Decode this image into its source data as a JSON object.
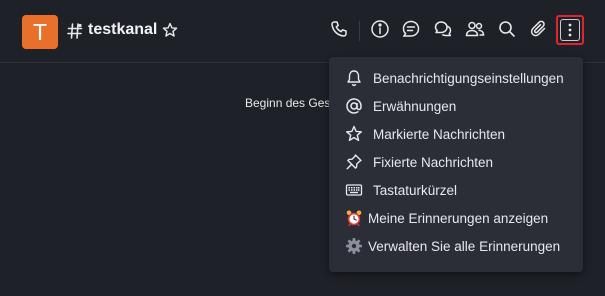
{
  "channel": {
    "avatar_letter": "T",
    "name": "testkanal"
  },
  "toolbar": {
    "icons": [
      "phone-icon",
      "info-icon",
      "threads-icon",
      "discussion-icon",
      "members-icon",
      "search-icon",
      "attachment-icon",
      "kebab-icon"
    ]
  },
  "main": {
    "begin_text": "Beginn des Gesp"
  },
  "menu": {
    "items": [
      {
        "label": "Benachrichtigungseinstellungen",
        "icon": "bell-icon"
      },
      {
        "label": "Erwähnungen",
        "icon": "at-icon"
      },
      {
        "label": "Markierte Nachrichten",
        "icon": "star-icon"
      },
      {
        "label": "Fixierte Nachrichten",
        "icon": "pin-icon"
      },
      {
        "label": "Tastaturkürzel",
        "icon": "keyboard-icon"
      },
      {
        "label": "Meine Erinnerungen anzeigen",
        "icon": "alarm-clock-icon"
      },
      {
        "label": "Verwalten Sie alle Erinnerungen",
        "icon": "gear-icon"
      }
    ]
  },
  "colors": {
    "background": "#1f2129",
    "menu_background": "#2b2d37",
    "avatar": "#e8702a",
    "highlight_border": "#e0262d"
  }
}
